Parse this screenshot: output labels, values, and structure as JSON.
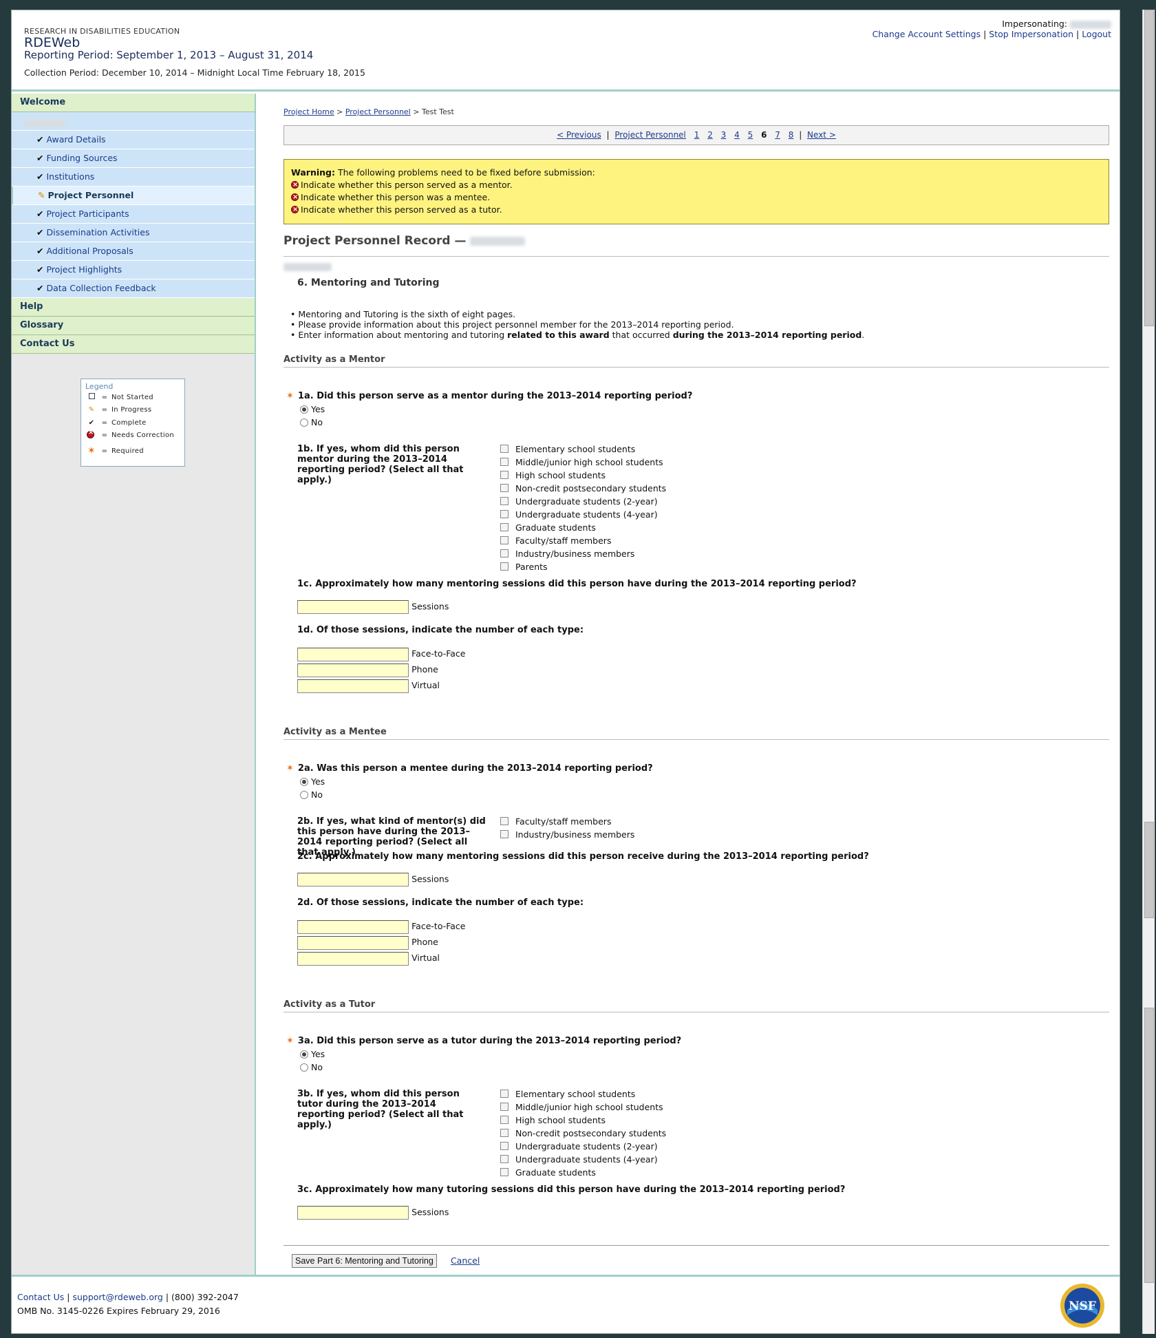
{
  "header": {
    "org": "RESEARCH IN DISABILITIES EDUCATION",
    "app_name": "RDEWeb",
    "reporting_period": "Reporting Period: September 1, 2013 – August 31, 2014",
    "collection_period": "Collection Period: December 10, 2014 – Midnight Local Time February 18, 2015",
    "impersonating_label": "Impersonating:",
    "change_settings": "Change Account Settings",
    "stop_impersonation": "Stop Impersonation",
    "logout": "Logout"
  },
  "sidebar": {
    "welcome": "Welcome",
    "items": [
      {
        "label": "Award Details"
      },
      {
        "label": "Funding Sources"
      },
      {
        "label": "Institutions"
      },
      {
        "label": "Project Personnel"
      },
      {
        "label": "Project Participants"
      },
      {
        "label": "Dissemination Activities"
      },
      {
        "label": "Additional Proposals"
      },
      {
        "label": "Project Highlights"
      },
      {
        "label": "Data Collection Feedback"
      }
    ],
    "help": "Help",
    "glossary": "Glossary",
    "contact": "Contact Us",
    "legend": {
      "title": "Legend",
      "eq": "=",
      "not_started": "Not Started",
      "in_progress": "In Progress",
      "complete": "Complete",
      "needs_correction": "Needs Correction",
      "required": "Required"
    }
  },
  "breadcrumb": {
    "home": "Project Home",
    "personnel": "Project Personnel",
    "current": "Test Test",
    "sep": ">"
  },
  "pager": {
    "previous": "< Previous",
    "personnel": "Project Personnel",
    "pages": [
      "1",
      "2",
      "3",
      "4",
      "5",
      "6",
      "7",
      "8"
    ],
    "current": "6",
    "next": "Next >"
  },
  "warning": {
    "title": "Warning:",
    "text": "The following problems need to be fixed before submission:",
    "items": [
      "Indicate whether this person served as a mentor.",
      "Indicate whether this person was a mentee.",
      "Indicate whether this person served as a tutor."
    ]
  },
  "record": {
    "title": "Project Personnel Record —",
    "section_title": "6. Mentoring and Tutoring",
    "intro": {
      "b1": "Mentoring and Tutoring is the sixth of eight pages.",
      "b2": "Please provide information about this project personnel member for the 2013–2014 reporting period.",
      "b3_a": "Enter information about mentoring and tutoring ",
      "b3_b": "related to this award",
      "b3_c": " that occurred ",
      "b3_d": "during the 2013–2014 reporting period",
      "b3_e": "."
    }
  },
  "mentor": {
    "heading": "Activity as a Mentor",
    "q1a": "1a. Did this person serve as a mentor during the 2013–2014 reporting period?",
    "yes": "Yes",
    "no": "No",
    "q1b": "1b. If yes, whom did this person mentor during the 2013–2014 reporting period? (Select all that apply.)",
    "options": [
      "Elementary school students",
      "Middle/junior high school students",
      "High school students",
      "Non-credit postsecondary students",
      "Undergraduate students (2-year)",
      "Undergraduate students (4-year)",
      "Graduate students",
      "Faculty/staff members",
      "Industry/business members",
      "Parents"
    ],
    "q1c": "1c. Approximately how many mentoring sessions did this person have during the 2013–2014 reporting period?",
    "sessions": "Sessions",
    "q1d": "1d. Of those sessions, indicate the number of each type:",
    "types": [
      "Face-to-Face",
      "Phone",
      "Virtual"
    ]
  },
  "mentee": {
    "heading": "Activity as a Mentee",
    "q2a": "2a. Was this person a mentee during the 2013–2014 reporting period?",
    "yes": "Yes",
    "no": "No",
    "q2b": "2b. If yes, what kind of mentor(s) did this person have during the 2013–2014 reporting period? (Select all that apply.)",
    "options": [
      "Faculty/staff members",
      "Industry/business members"
    ],
    "q2c": "2c. Approximately how many mentoring sessions did this person receive during the 2013–2014 reporting period?",
    "sessions": "Sessions",
    "q2d": "2d. Of those sessions, indicate the number of each type:",
    "types": [
      "Face-to-Face",
      "Phone",
      "Virtual"
    ]
  },
  "tutor": {
    "heading": "Activity as a Tutor",
    "q3a": "3a. Did this person serve as a tutor during the 2013–2014 reporting period?",
    "yes": "Yes",
    "no": "No",
    "q3b": "3b. If yes, whom did this person tutor during the 2013–2014 reporting period? (Select all that apply.)",
    "options": [
      "Elementary school students",
      "Middle/junior high school students",
      "High school students",
      "Non-credit postsecondary students",
      "Undergraduate students (2-year)",
      "Undergraduate students (4-year)",
      "Graduate students"
    ],
    "q3c": "3c. Approximately how many tutoring sessions did this person have during the 2013–2014 reporting period?",
    "sessions": "Sessions"
  },
  "actions": {
    "save": "Save Part 6: Mentoring and Tutoring",
    "cancel": "Cancel"
  },
  "footer": {
    "contact": "Contact Us",
    "email": "support@rdeweb.org",
    "phone": "(800) 392-2047",
    "sep": "|",
    "omb": "OMB No. 3145-0226 Expires February 29, 2016",
    "logo_text": "NSF"
  },
  "colors": {
    "accent_teal": "#9fd0c8",
    "nav_green": "#dff0cc",
    "nav_blue": "#cde4f8",
    "warning_bg": "#fff380",
    "input_bg": "#ffffcc",
    "required_star": "#e86a10"
  }
}
